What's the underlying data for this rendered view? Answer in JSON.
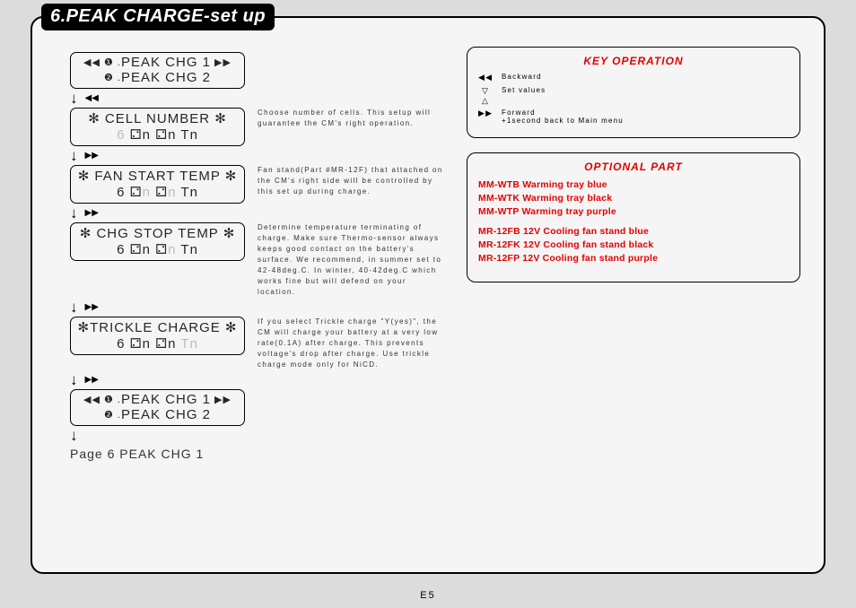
{
  "title": "6.PEAK CHARGE-set up",
  "page_number": "E5",
  "flow": {
    "step1": {
      "line1_pre": "◀◀  ❶ .",
      "line1_label": "PEAK CHG 1",
      "line1_post": "  ▶▶",
      "line2_pre": "❷ .",
      "line2_label": "PEAK CHG 2"
    },
    "arrow1_icon": "◀◀",
    "step2": {
      "title": "✻  CELL NUMBER  ✻",
      "row_gray1": "6",
      "row_black1": "   ⚁n   ⚁n     Tn"
    },
    "note2": "Choose number of cells.\nThis setup will guarantee the CM's right operation.",
    "arrow2_icon": "▶▶",
    "step3": {
      "title": "✻ FAN START TEMP ✻",
      "l": "6   ⚁",
      "g1": "n",
      "m": "   ⚁",
      "g2": "n",
      "r": "     Tn"
    },
    "note3": "Fan stand(Part #MR-12F) that attached on the CM's right side will be controlled by this set up during charge.",
    "arrow3_icon": "▶▶",
    "step4": {
      "title": "✻ CHG STOP TEMP ✻",
      "l": "6   ⚁n   ⚁",
      "g": "n",
      "r": "     Tn"
    },
    "note4": "Determine temperature terminating of charge.\nMake sure Thermo-sensor always keeps good contact on the battery's surface.\nWe recommend, in summer set to 42-48deg.C. In winter, 40-42deg.C which works fine but will defend on your location.",
    "arrow4_icon": "▶▶",
    "step5": {
      "title": "✻TRICKLE CHARGE ✻",
      "l": "6   ⚁n   ⚁n     ",
      "g": "Tn"
    },
    "note5": "If you select Trickle charge \"Y(yes)\", the CM will charge your battery at a very low rate(0.1A) after charge.\nThis prevents voltage's drop after charge.\nUse trickle charge mode only for NiCD.",
    "arrow5_icon": "▶▶",
    "step6": {
      "line1_pre": "◀◀  ❶ .",
      "line1_label": "PEAK CHG 1",
      "line1_post": "  ▶▶",
      "line2_pre": "❷ .",
      "line2_label": "PEAK CHG 2"
    },
    "footer": "Page 6 PEAK CHG 1"
  },
  "key_operation": {
    "title": "KEY OPERATION",
    "rows": [
      {
        "icons": "◀◀",
        "text": "Backward"
      },
      {
        "icons": "▽ △",
        "text": "Set values"
      },
      {
        "icons": "▶▶",
        "text": "Forward\n+1second back to Main menu"
      }
    ]
  },
  "optional": {
    "title": "OPTIONAL PART",
    "group1": [
      "MM-WTB Warming tray blue",
      "MM-WTK Warming tray black",
      "MM-WTP Warming tray purple"
    ],
    "group2": [
      "MR-12FB 12V Cooling fan stand blue",
      "MR-12FK 12V Cooling fan stand black",
      "MR-12FP 12V Cooling fan stand purple"
    ]
  }
}
